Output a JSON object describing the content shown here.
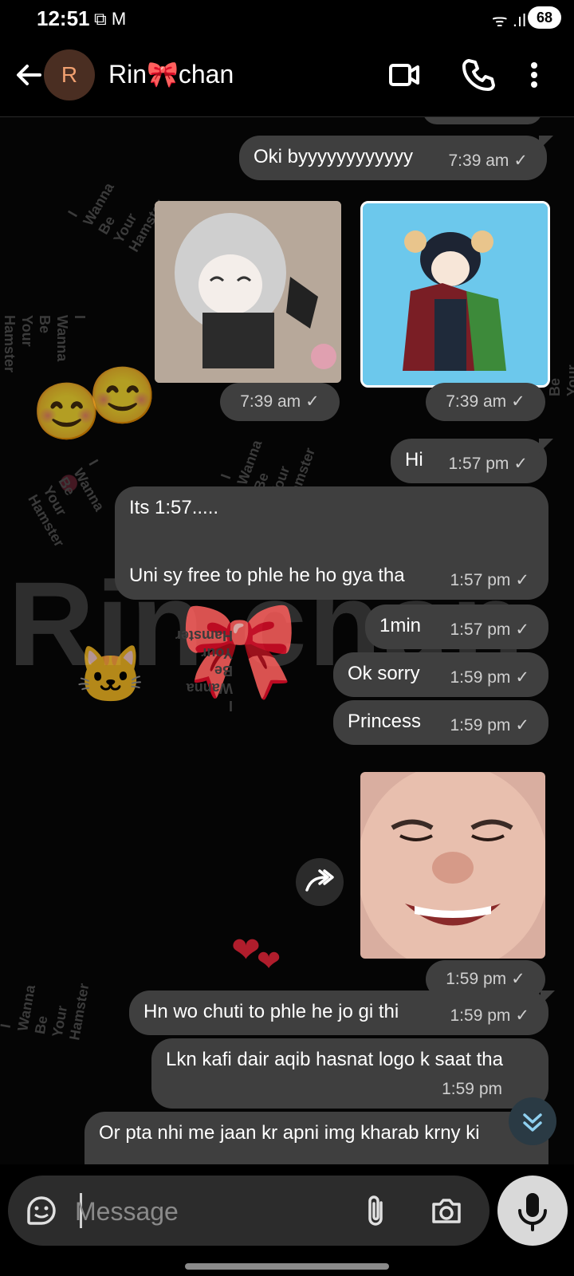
{
  "status_bar": {
    "time": "12:51",
    "battery": "68",
    "left_icons": "⧉ M",
    "right_icons": "ᯤ .ıl"
  },
  "header": {
    "avatar_letter": "R",
    "contact_name": "Rin🎀chan"
  },
  "watermark": {
    "big_text": "Rin   chan",
    "hamster_text": "I\nWanna\nBe\nYour\nHamster"
  },
  "messages": [
    {
      "text": "Oki byyyyyyyyyyyy",
      "time": "7:39 am"
    },
    {
      "type": "image",
      "time": "7:39 am"
    },
    {
      "type": "image",
      "time": "7:39 am"
    },
    {
      "text": "Hi",
      "time": "1:57 pm"
    },
    {
      "text_line1": "Its 1:57.....",
      "text_line2": "Uni sy free to phle he ho gya tha",
      "time": "1:57 pm"
    },
    {
      "text": "1min",
      "time": "1:57 pm"
    },
    {
      "text": "Ok sorry",
      "time": "1:59 pm"
    },
    {
      "text": "Princess",
      "time": "1:59 pm"
    },
    {
      "type": "image",
      "time": "1:59 pm"
    },
    {
      "text": "Hn wo chuti to phle he jo gi thi",
      "time": "1:59 pm"
    },
    {
      "text": "Lkn kafi dair aqib hasnat logo k saat tha",
      "time": "1:59 pm"
    },
    {
      "text": "Or pta nhi me jaan kr apni img kharab krny ki"
    }
  ],
  "composer": {
    "placeholder": "Message"
  },
  "icons": {
    "back": "back-arrow-icon",
    "video": "video-call-icon",
    "call": "phone-icon",
    "more": "more-vert-icon",
    "sticker": "sticker-icon",
    "attach": "paperclip-icon",
    "camera": "camera-icon",
    "mic": "microphone-icon",
    "forward": "forward-icon",
    "scroll": "scroll-down-icon",
    "read": "check-icon"
  }
}
